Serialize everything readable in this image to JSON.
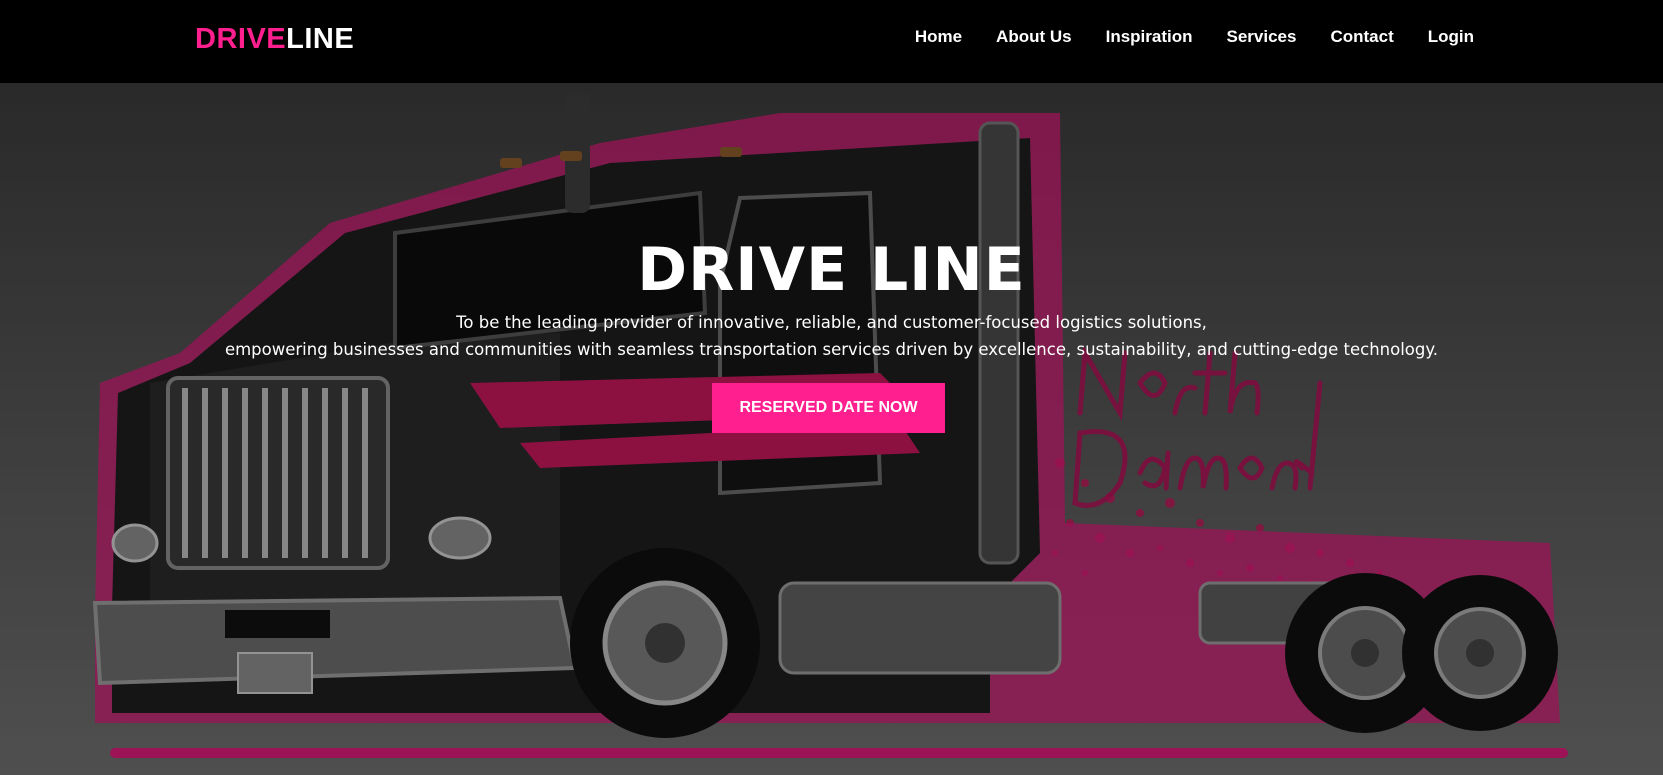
{
  "brand": {
    "logo_part_a": "DRIVE",
    "logo_part_b": "LINE",
    "accent_color": "#ff1f8e"
  },
  "nav": {
    "items": [
      {
        "label": "Home"
      },
      {
        "label": "About Us"
      },
      {
        "label": "Inspiration"
      },
      {
        "label": "Services"
      },
      {
        "label": "Contact"
      },
      {
        "label": "Login"
      }
    ]
  },
  "hero": {
    "title": "DRIVE LINE",
    "text_line_1": "To be the leading provider of innovative, reliable, and customer-focused logistics solutions,",
    "text_line_2": "empowering businesses and communities with seamless transportation services driven by excellence, sustainability, and cutting-edge technology.",
    "cta_label": "RESERVED DATE NOW",
    "background_image": {
      "subject": "pink and black semi truck illustration",
      "lettering": "North Diamond"
    }
  }
}
